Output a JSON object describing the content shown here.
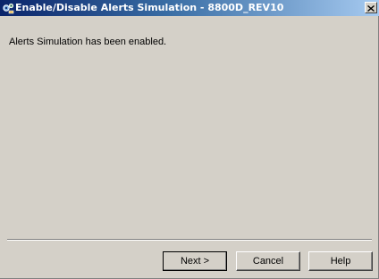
{
  "window": {
    "title": "Enable/Disable Alerts Simulation - 8800D_REV10",
    "title_icon": "gear-dialog-icon",
    "close_icon": "close-icon"
  },
  "content": {
    "message": "Alerts Simulation has been enabled."
  },
  "buttons": {
    "next_label": "Next >",
    "cancel_label": "Cancel",
    "help_label": "Help"
  },
  "colors": {
    "titlebar_start": "#0a246a",
    "titlebar_end": "#a6caf0",
    "dialog_background": "#d4d0c8"
  }
}
